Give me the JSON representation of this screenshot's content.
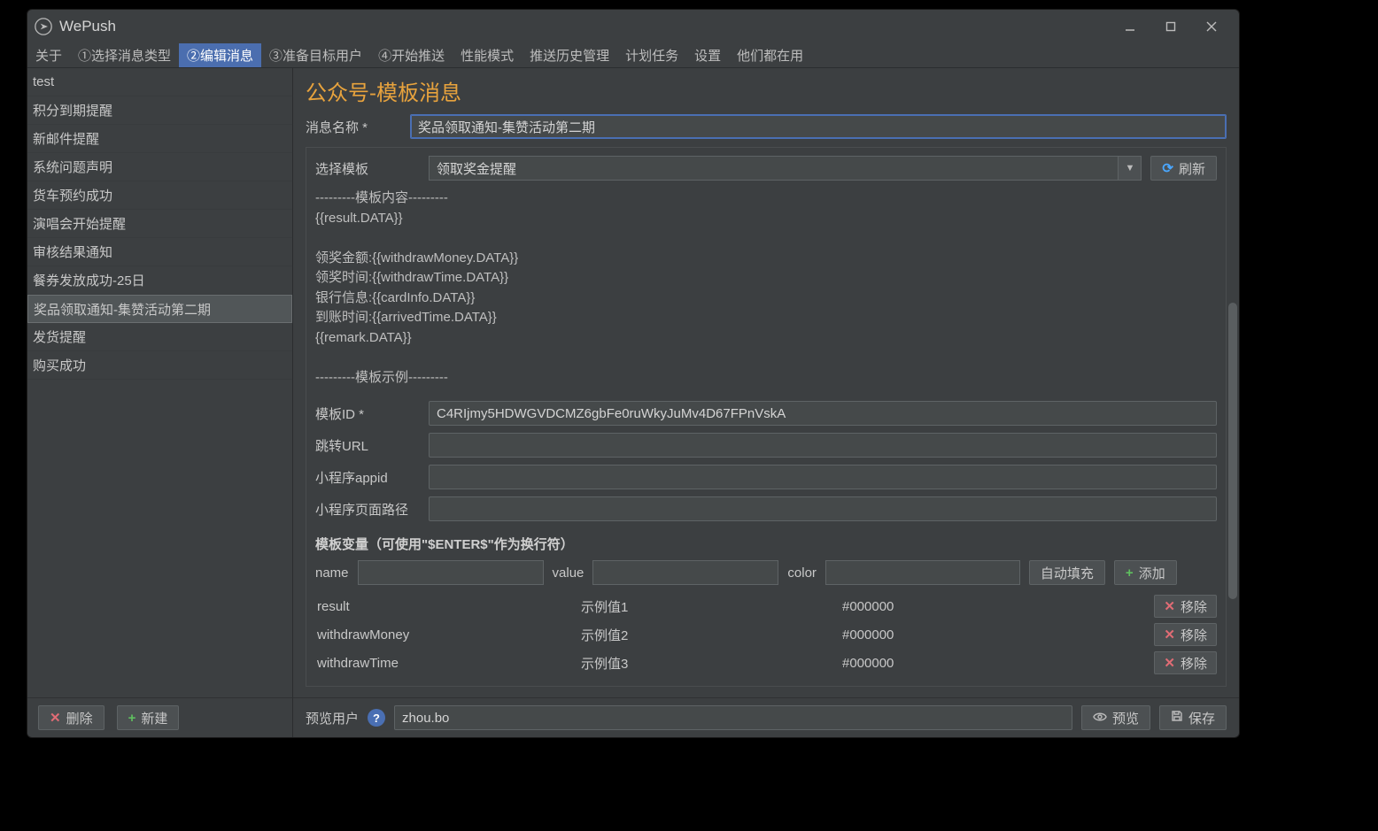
{
  "app": {
    "title": "WePush"
  },
  "tabs": [
    {
      "label": "关于",
      "active": false
    },
    {
      "label": "①选择消息类型",
      "active": false
    },
    {
      "label": "②编辑消息",
      "active": true
    },
    {
      "label": "③准备目标用户",
      "active": false
    },
    {
      "label": "④开始推送",
      "active": false
    },
    {
      "label": "性能模式",
      "active": false
    },
    {
      "label": "推送历史管理",
      "active": false
    },
    {
      "label": "计划任务",
      "active": false
    },
    {
      "label": "设置",
      "active": false
    },
    {
      "label": "他们都在用",
      "active": false
    }
  ],
  "sidebar": {
    "items": [
      {
        "label": "test",
        "selected": false
      },
      {
        "label": "积分到期提醒",
        "selected": false
      },
      {
        "label": "新邮件提醒",
        "selected": false
      },
      {
        "label": "系统问题声明",
        "selected": false
      },
      {
        "label": "货车预约成功",
        "selected": false
      },
      {
        "label": "演唱会开始提醒",
        "selected": false
      },
      {
        "label": "审核结果通知",
        "selected": false
      },
      {
        "label": "餐券发放成功-25日",
        "selected": false
      },
      {
        "label": "奖品领取通知-集赞活动第二期",
        "selected": true
      },
      {
        "label": "发货提醒",
        "selected": false
      },
      {
        "label": "购买成功",
        "selected": false
      }
    ],
    "delete_label": "删除",
    "new_label": "新建"
  },
  "main": {
    "title": "公众号-模板消息",
    "msg_name_label": "消息名称",
    "msg_name_value": "奖品领取通知-集赞活动第二期",
    "select_template_label": "选择模板",
    "selected_template": "领取奖金提醒",
    "refresh_label": "刷新",
    "template_content": "---------模板内容---------\n{{result.DATA}}\n\n领奖金额:{{withdrawMoney.DATA}}\n领奖时间:{{withdrawTime.DATA}}\n银行信息:{{cardInfo.DATA}}\n到账时间:{{arrivedTime.DATA}}\n{{remark.DATA}}\n\n---------模板示例---------",
    "template_id_label": "模板ID",
    "template_id_value": "C4RIjmy5HDWGVDCMZ6gbFe0ruWkyJuMv4D67FPnVskA",
    "jump_url_label": "跳转URL",
    "jump_url_value": "",
    "mini_appid_label": "小程序appid",
    "mini_appid_value": "",
    "mini_path_label": "小程序页面路径",
    "mini_path_value": "",
    "vars_title": "模板变量（可使用\"$ENTER$\"作为换行符）",
    "var_labels": {
      "name": "name",
      "value": "value",
      "color": "color"
    },
    "var_inputs": {
      "name": "",
      "value": "",
      "color": ""
    },
    "autofill_label": "自动填充",
    "add_label": "添加",
    "remove_label": "移除",
    "var_rows": [
      {
        "name": "result",
        "value": "示例值1",
        "color": "#000000"
      },
      {
        "name": "withdrawMoney",
        "value": "示例值2",
        "color": "#000000"
      },
      {
        "name": "withdrawTime",
        "value": "示例值3",
        "color": "#000000"
      }
    ]
  },
  "footer": {
    "preview_user_label": "预览用户",
    "preview_user_value": "zhou.bo",
    "preview_label": "预览",
    "save_label": "保存"
  }
}
